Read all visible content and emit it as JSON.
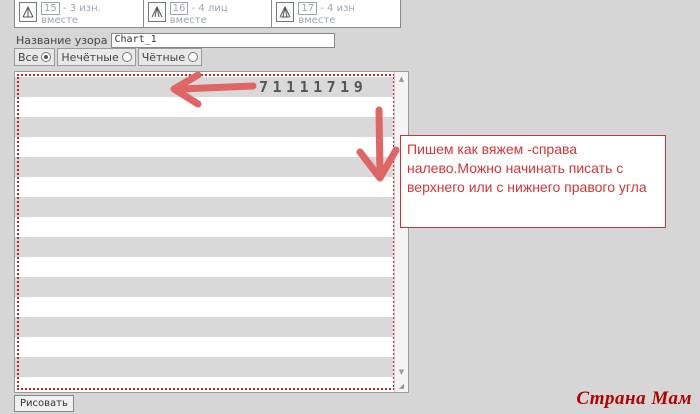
{
  "legend": [
    {
      "num": "15",
      "line1": "- 3 изн.",
      "line2": "вместе",
      "icon": "knit-together-3-icon"
    },
    {
      "num": "16",
      "line1": "- 4 лиц",
      "line2": "вместе",
      "icon": "knit-together-4-icon"
    },
    {
      "num": "17",
      "line1": "- 4 изн",
      "line2": "вместе",
      "icon": "purl-together-4-icon"
    }
  ],
  "pattern_name": {
    "label": "Название узора",
    "value": "Chart_1"
  },
  "filters": [
    {
      "label": "Все",
      "selected": true
    },
    {
      "label": "Нечётные",
      "selected": false
    },
    {
      "label": "Чётные",
      "selected": false
    }
  ],
  "chart": {
    "digits": "71111719"
  },
  "draw_button": "Рисовать",
  "note": "Пишем как вяжем -справа налево.Можно начинать писать с верхнего или с нижнего правого угла",
  "watermark": "Страна Мам",
  "colors": {
    "arrow": "#e06666",
    "note_border": "#cc3333",
    "note_text": "#dd3333",
    "watermark": "#b30000"
  }
}
